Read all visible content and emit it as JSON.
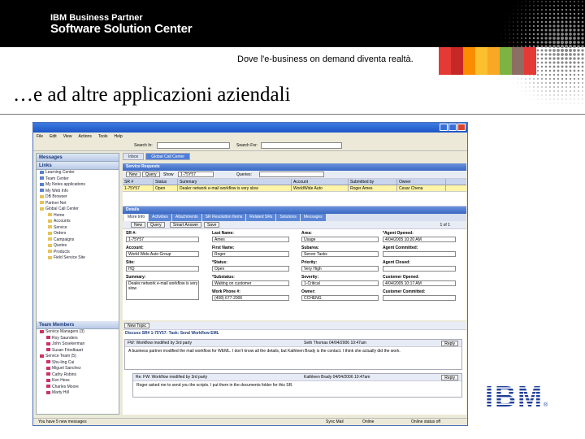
{
  "header": {
    "line1": "IBM Business Partner",
    "line2": "Software Solution Center",
    "tagline": "Dove l'e-business on demand diventa realtà.",
    "stripe_colors": [
      "#e53935",
      "#c62828",
      "#fb8c00",
      "#fbc02d",
      "#f9a825",
      "#7cb342",
      "#8d6e63",
      "#e53935"
    ]
  },
  "slide": {
    "title": "…e ad altre applicazioni aziendali",
    "logo_text": "IBM",
    "registered": "®"
  },
  "app": {
    "menu": [
      "File",
      "Edit",
      "View",
      "Actions",
      "Tools",
      "Help"
    ],
    "search_in_label": "Search In:",
    "search_for_label": "Search For:",
    "tabs": [
      "Inbox",
      "Global Call Center"
    ],
    "left_panel": {
      "messages_header": "Messages",
      "links_header": "Links",
      "links": [
        "Learning Center",
        "Team Center",
        "My Notes applications",
        "My Web Info",
        "DB Browser",
        "Partner Net",
        "Global Call Center",
        "Home",
        "Accounts",
        "Service",
        "Orders",
        "Campaigns",
        "Quotes",
        "Products",
        "Field Service Site"
      ],
      "team_header": "Team Members",
      "team": [
        "Service Managers (3)",
        "Roy Saunders",
        "John Sosekerman",
        "Susan Friedkaart",
        "Service Team (5)",
        "Shu-ling Cai",
        "Miguel Sanchez",
        "Cathy Robins",
        "Ken Hess",
        "Charles Moore",
        "Marty Hill"
      ]
    },
    "service_requests": {
      "title": "Service Requests",
      "new_label": "New",
      "query_label": "Query",
      "show_label": "Show",
      "show_value": "1-75Y57",
      "queries_label": "Queries:",
      "columns": [
        "SR #",
        "Status",
        "Summary",
        "Account",
        "Submitted by",
        "Owner"
      ],
      "row": [
        "1-75Y57",
        "Open",
        "Dealer network e-mail workflow is very slow",
        "WorldWide Auto",
        "Roger Ames",
        "Cesar Chena"
      ]
    },
    "details": {
      "title": "Details",
      "subtabs": [
        "More Info",
        "Activities",
        "Attachments",
        "SR Resolution Items",
        "Related SRs",
        "Solutions",
        "Messages"
      ],
      "buttons": [
        "New",
        "Query",
        "Smart Answer",
        "Save"
      ],
      "pager": "1 of 1",
      "fields": {
        "sr_label": "SR #:",
        "sr": "1-75Y57",
        "last_name_label": "Last Name:",
        "last_name": "Ames",
        "area_label": "Area:",
        "area": "Usage",
        "agent_opened_label": "*Agent Opened:",
        "agent_opened": "4/04/2005 10:20 AM",
        "account_label": "Account:",
        "account": "World Wide Auto Group",
        "first_name_label": "First Name:",
        "first_name": "Roger",
        "subarea_label": "Subarea:",
        "subarea": "Server Tasks",
        "agent_committed_label": "Agent Committed:",
        "site_label": "Site:",
        "site": "HQ",
        "status_label": "*Status:",
        "status": "Open",
        "priority_label": "Priority:",
        "priority": "Very High",
        "agent_closed_label": "Agent Closed:",
        "summary_label": "Summary:",
        "summary": "Dealer network e-mail workflow is very slow",
        "substatus_label": "*Substatus:",
        "substatus": "Waiting on customer",
        "severity_label": "Severity:",
        "severity": "1-Critical",
        "customer_opened_label": "Customer Opened:",
        "customer_opened": "4/04/2005 10:17 AM",
        "work_phone_label": "Work Phone #:",
        "work_phone": "(408) 677-2006",
        "owner_label": "Owner:",
        "owner": "CCHENG",
        "customer_committed_label": "Customer Committed:"
      }
    },
    "memo": {
      "new_topic": "New Topic",
      "thread_title": "Discuss SR# 1-75Y57: Task: Send Workflow EML",
      "messages": [
        {
          "subject": "FW: Workflow modified by 3rd party",
          "author": "Seth Thomas 04/04/2006 10:47am",
          "reply": "Reply",
          "body": "A business partner modified the mail workflow for WEML. I don't know all the details, but Kathleen Brady is the contact. I think she actually did the work."
        },
        {
          "subject": "Re: FW: Workflow modified by 3rd party",
          "author": "Kathleen Brady 04/04/2006 10:47am",
          "reply": "Reply",
          "body": "Roger asked me to send you the scripts. I put them in the documents folder for this SR."
        }
      ]
    },
    "statusbar": {
      "messages": "You have 5 new messages",
      "sync": "Sync Mail",
      "online": "Online",
      "status": "Online status off"
    }
  }
}
